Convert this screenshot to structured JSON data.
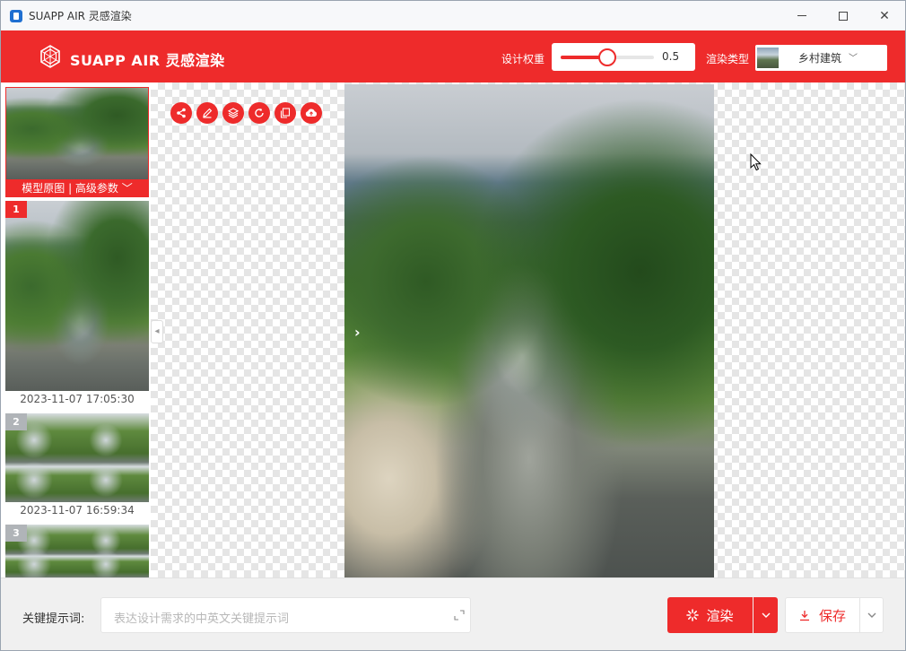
{
  "window": {
    "title": "SUAPP AIR 灵感渲染",
    "controls": {
      "minimize_icon": "minimize-icon",
      "maximize_icon": "maximize-icon",
      "close_label": "✕"
    }
  },
  "header": {
    "brand": "SUAPP AIR 灵感渲染",
    "design_weight": {
      "label": "设计权重",
      "value": "0.5",
      "level": 0.5
    },
    "render_type": {
      "label": "渲染类型",
      "value": "乡村建筑",
      "chevron": "﹀"
    }
  },
  "sidebar": {
    "model_original": {
      "caption": "模型原图 | 高级参数 ﹀"
    },
    "results": [
      {
        "number": "1",
        "timestamp": "2023-11-07 17:05:30"
      },
      {
        "number": "2",
        "timestamp": "2023-11-07 16:59:34"
      },
      {
        "number": "3",
        "timestamp": ""
      }
    ],
    "collapse_glyph": "◂"
  },
  "toolbar": {
    "buttons": [
      {
        "icon": "share-icon"
      },
      {
        "icon": "edit-icon"
      },
      {
        "icon": "layers-icon"
      },
      {
        "icon": "refresh-icon"
      },
      {
        "icon": "copy-icon"
      },
      {
        "icon": "upload-cloud-icon"
      }
    ]
  },
  "canvas": {
    "next_glyph": "›"
  },
  "bottom": {
    "prompt_label": "关键提示词:",
    "prompt_placeholder": "表达设计需求的中英文关键提示词",
    "render_label": "渲染",
    "save_label": "保存"
  },
  "colors": {
    "accent": "#ee2b2b",
    "panel": "#f0f0f0"
  }
}
